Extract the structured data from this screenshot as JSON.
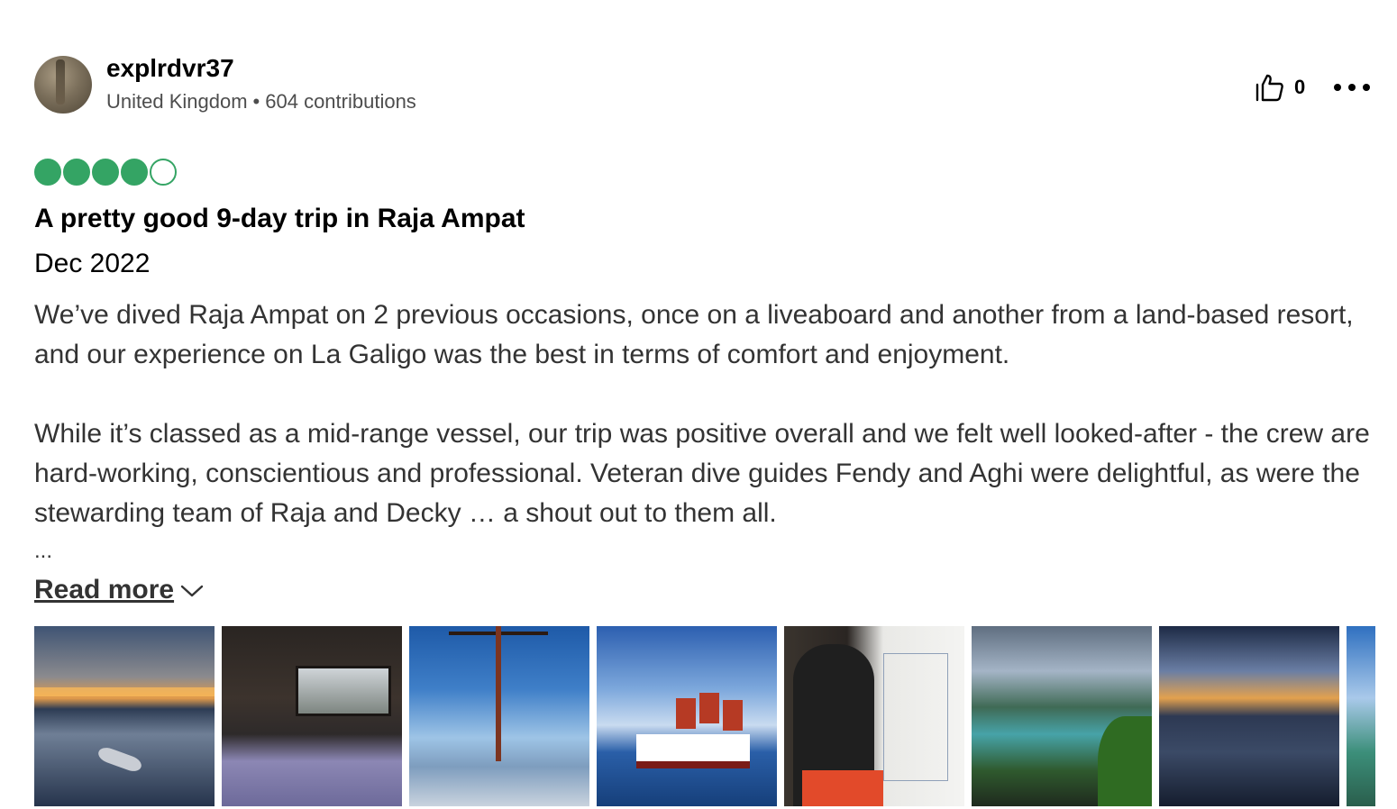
{
  "reviewer": {
    "username": "explrdvr37",
    "location": "United Kingdom",
    "separator": "•",
    "contributions": "604 contributions"
  },
  "actions": {
    "helpful_count": "0"
  },
  "review": {
    "rating": 4,
    "rating_max": 5,
    "rating_color": "#34a464",
    "title": "A pretty good 9-day trip in Raja Ampat",
    "date": "Dec 2022",
    "paragraphs": [
      "We’ve dived Raja Ampat on 2 previous occasions, once on a liveaboard and another from a land-based resort, and our experience on La Galigo was the best in terms of comfort and enjoyment.",
      "While it’s classed as a mid-range vessel, our trip was positive overall and we felt well looked-after - the crew are hard-working, conscientious and professional. Veteran dive guides Fendy and Aghi were delightful, as were the stewarding team of Raja and Decky … a shout out to them all."
    ],
    "truncation": "...",
    "read_more_label": "Read more"
  },
  "icons": {
    "helpful": "thumbs-up-icon",
    "more": "more-options-icon",
    "expand": "chevron-down-icon"
  }
}
